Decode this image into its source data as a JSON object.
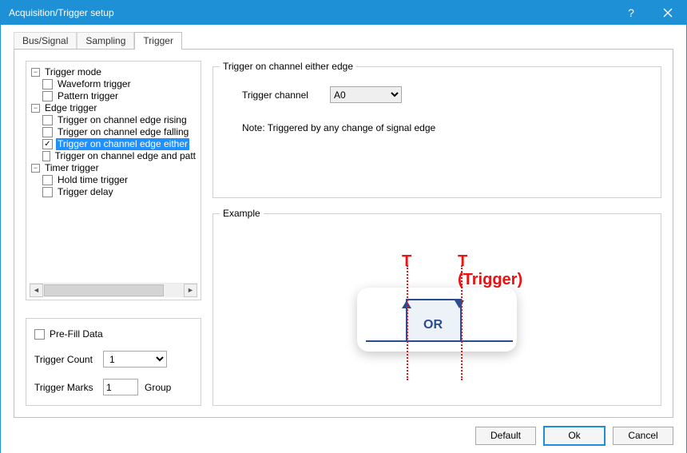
{
  "titlebar": {
    "title": "Acquisition/Trigger setup"
  },
  "tabs": {
    "t0": "Bus/Signal",
    "t1": "Sampling",
    "t2": "Trigger"
  },
  "tree": {
    "trigger_mode": "Trigger mode",
    "waveform_trigger": "Waveform trigger",
    "pattern_trigger": "Pattern trigger",
    "edge_trigger": "Edge trigger",
    "edge_rising": "Trigger on channel edge rising",
    "edge_falling": "Trigger on channel edge falling",
    "edge_either": "Trigger on channel edge either",
    "edge_and_patt": "Trigger on channel edge and patt",
    "timer_trigger": "Timer trigger",
    "hold_time": "Hold time trigger",
    "trigger_delay": "Trigger delay"
  },
  "left_settings": {
    "prefill_label": "Pre-Fill Data",
    "trigger_count_label": "Trigger Count",
    "trigger_count_value": "1",
    "trigger_marks_label": "Trigger Marks",
    "trigger_marks_value": "1",
    "group_label": "Group"
  },
  "right": {
    "group_title": "Trigger on channel either edge",
    "channel_label": "Trigger channel",
    "channel_value": "A0",
    "note": "Note: Triggered by any change of signal edge",
    "example_title": "Example",
    "t_label1": "T",
    "t_label2": "T (Trigger)",
    "or_label": "OR"
  },
  "footer": {
    "default": "Default",
    "ok": "Ok",
    "cancel": "Cancel"
  }
}
